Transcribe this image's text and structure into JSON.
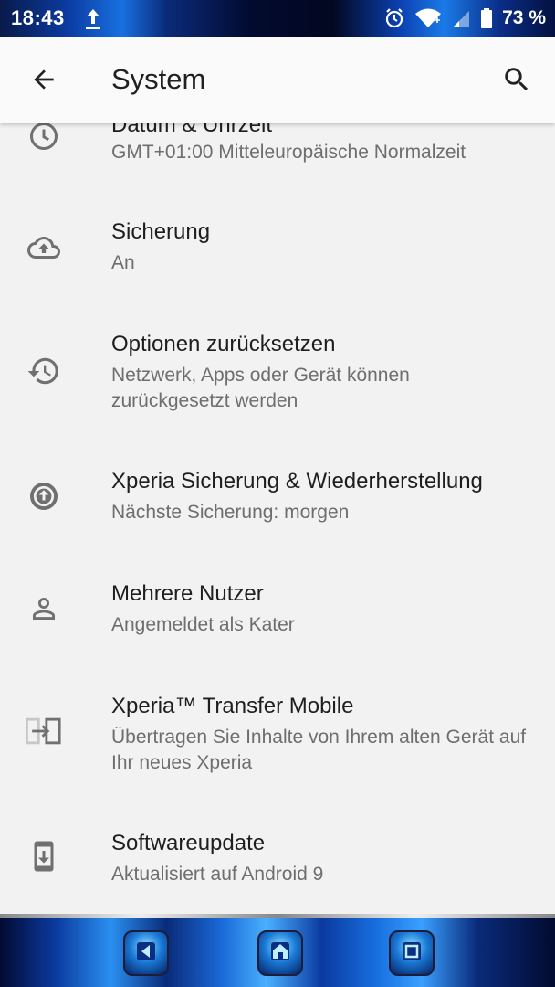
{
  "status_bar": {
    "time": "18:43",
    "battery": "73 %",
    "icons": [
      "upload-icon",
      "alarm-icon",
      "wifi-icon",
      "signal-icon",
      "battery-icon"
    ]
  },
  "app_bar": {
    "title": "System",
    "back_icon": "arrow-back-icon",
    "search_icon": "search-icon"
  },
  "items": [
    {
      "title": "Datum & Uhrzeit",
      "subtitle": "GMT+01:00 Mitteleuropäische Normalzeit",
      "icon": "clock-icon"
    },
    {
      "title": "Sicherung",
      "subtitle": "An",
      "icon": "cloud-upload-icon"
    },
    {
      "title": "Optionen zurücksetzen",
      "subtitle": "Netzwerk, Apps oder Gerät können zurückgesetzt werden",
      "icon": "history-icon"
    },
    {
      "title": "Xperia Sicherung & Wiederherstellung",
      "subtitle": "Nächste Sicherung: morgen",
      "icon": "backup-restore-icon"
    },
    {
      "title": "Mehrere Nutzer",
      "subtitle": "Angemeldet als Kater",
      "icon": "person-icon"
    },
    {
      "title": "Xperia™ Transfer Mobile",
      "subtitle": "Übertragen Sie Inhalte von Ihrem alten Gerät auf Ihr neues Xperia",
      "icon": "transfer-icon"
    },
    {
      "title": "Softwareupdate",
      "subtitle": "Aktualisiert auf Android 9",
      "icon": "system-update-icon"
    }
  ],
  "nav_bar": {
    "buttons": [
      "back-nav-icon",
      "home-nav-icon",
      "recents-nav-icon"
    ]
  }
}
